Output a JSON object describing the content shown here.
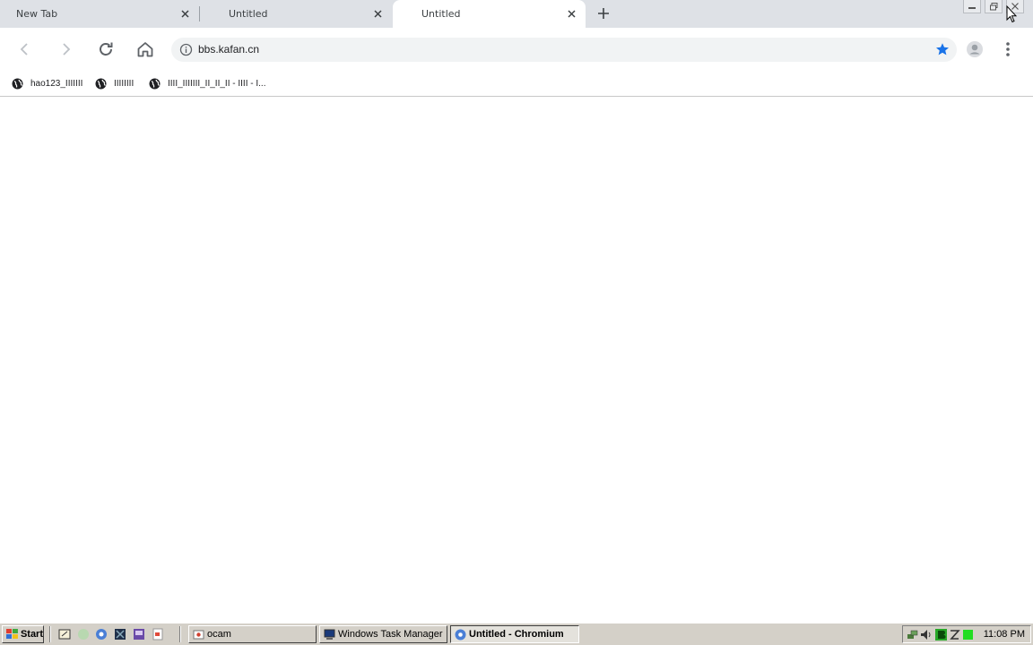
{
  "tabs": [
    {
      "title": "New Tab",
      "active": false
    },
    {
      "title": "Untitled",
      "active": false
    },
    {
      "title": "Untitled",
      "active": true
    }
  ],
  "toolbar": {
    "url": "bbs.kafan.cn",
    "back_icon": "back-arrow-icon",
    "forward_icon": "forward-arrow-icon",
    "reload_icon": "reload-icon",
    "home_icon": "home-icon",
    "bookmark_star_color": "#1a73e8"
  },
  "bookmarks": [
    {
      "label": "hao123_IIIIIII"
    },
    {
      "label": "IIIIIIII"
    },
    {
      "label": "IIII_IIIIIII_II_II_II - IIII - I..."
    }
  ],
  "taskbar": {
    "start_label": "Start",
    "tasks": [
      {
        "label": "ocam",
        "active": false
      },
      {
        "label": "Windows Task Manager",
        "active": false
      },
      {
        "label": "Untitled - Chromium",
        "active": true
      }
    ],
    "clock": "11:08 PM"
  }
}
